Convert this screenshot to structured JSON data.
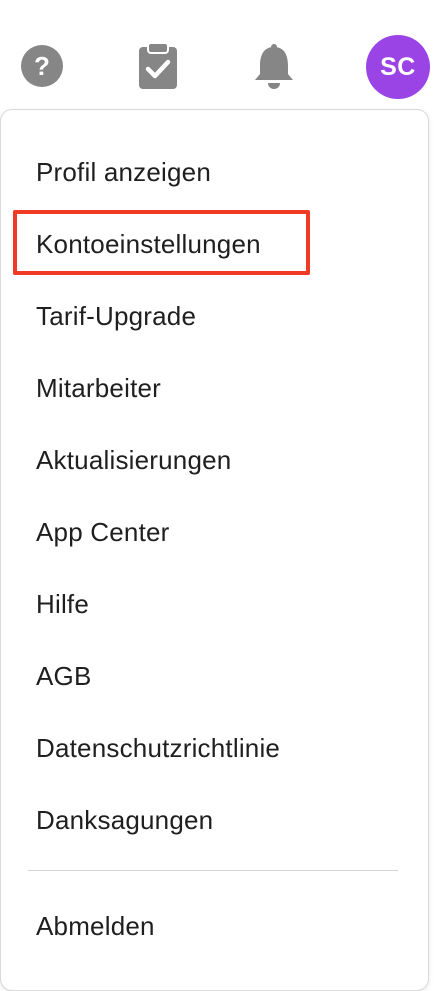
{
  "toolbar": {
    "help_icon": "question-circle-icon",
    "tasks_icon": "clipboard-check-icon",
    "bell_icon": "bell-icon",
    "avatar_initials": "SC",
    "avatar_color": "#9b44e6",
    "icon_color": "#868686"
  },
  "menu": {
    "items": [
      {
        "label": "Profil anzeigen"
      },
      {
        "label": "Kontoeinstellungen",
        "highlighted": true
      },
      {
        "label": "Tarif-Upgrade"
      },
      {
        "label": "Mitarbeiter"
      },
      {
        "label": "Aktualisierungen"
      },
      {
        "label": "App Center"
      },
      {
        "label": "Hilfe"
      },
      {
        "label": "AGB"
      },
      {
        "label": "Datenschutzrichtlinie"
      },
      {
        "label": "Danksagungen"
      }
    ],
    "logout_label": "Abmelden",
    "highlight_color": "#f03a24"
  }
}
